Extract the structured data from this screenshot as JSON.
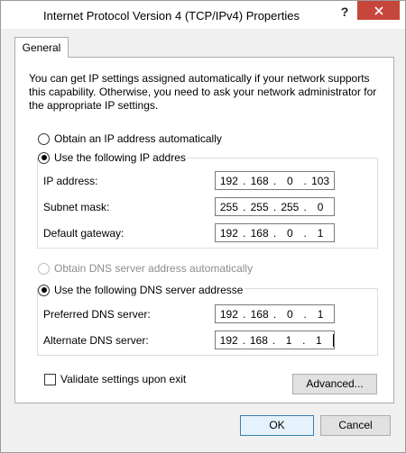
{
  "window": {
    "title": "Internet Protocol Version 4 (TCP/IPv4) Properties",
    "help_glyph": "?",
    "close_glyph": "✕"
  },
  "tabs": [
    {
      "label": "General"
    }
  ],
  "general": {
    "description": "You can get IP settings assigned automatically if your network supports this capability. Otherwise, you need to ask your network administrator for the appropriate IP settings.",
    "ip_auto_label": "Obtain an IP address automatically",
    "ip_manual_label": "Use the following IP addres",
    "ip_fields": [
      {
        "label": "IP address:",
        "octets": [
          "192",
          "168",
          "0",
          "103"
        ]
      },
      {
        "label": "Subnet mask:",
        "octets": [
          "255",
          "255",
          "255",
          "0"
        ]
      },
      {
        "label": "Default gateway:",
        "octets": [
          "192",
          "168",
          "0",
          "1"
        ]
      }
    ],
    "dns_auto_label": "Obtain DNS server address automatically",
    "dns_manual_label": "Use the following DNS server addresse",
    "dns_fields": [
      {
        "label": "Preferred DNS server:",
        "octets": [
          "192",
          "168",
          "0",
          "1"
        ]
      },
      {
        "label": "Alternate DNS server:",
        "octets": [
          "192",
          "168",
          "1",
          "1"
        ]
      }
    ],
    "validate_label": "Validate settings upon exit",
    "advanced_label": "Advanced..."
  },
  "footer": {
    "ok_label": "OK",
    "cancel_label": "Cancel"
  }
}
